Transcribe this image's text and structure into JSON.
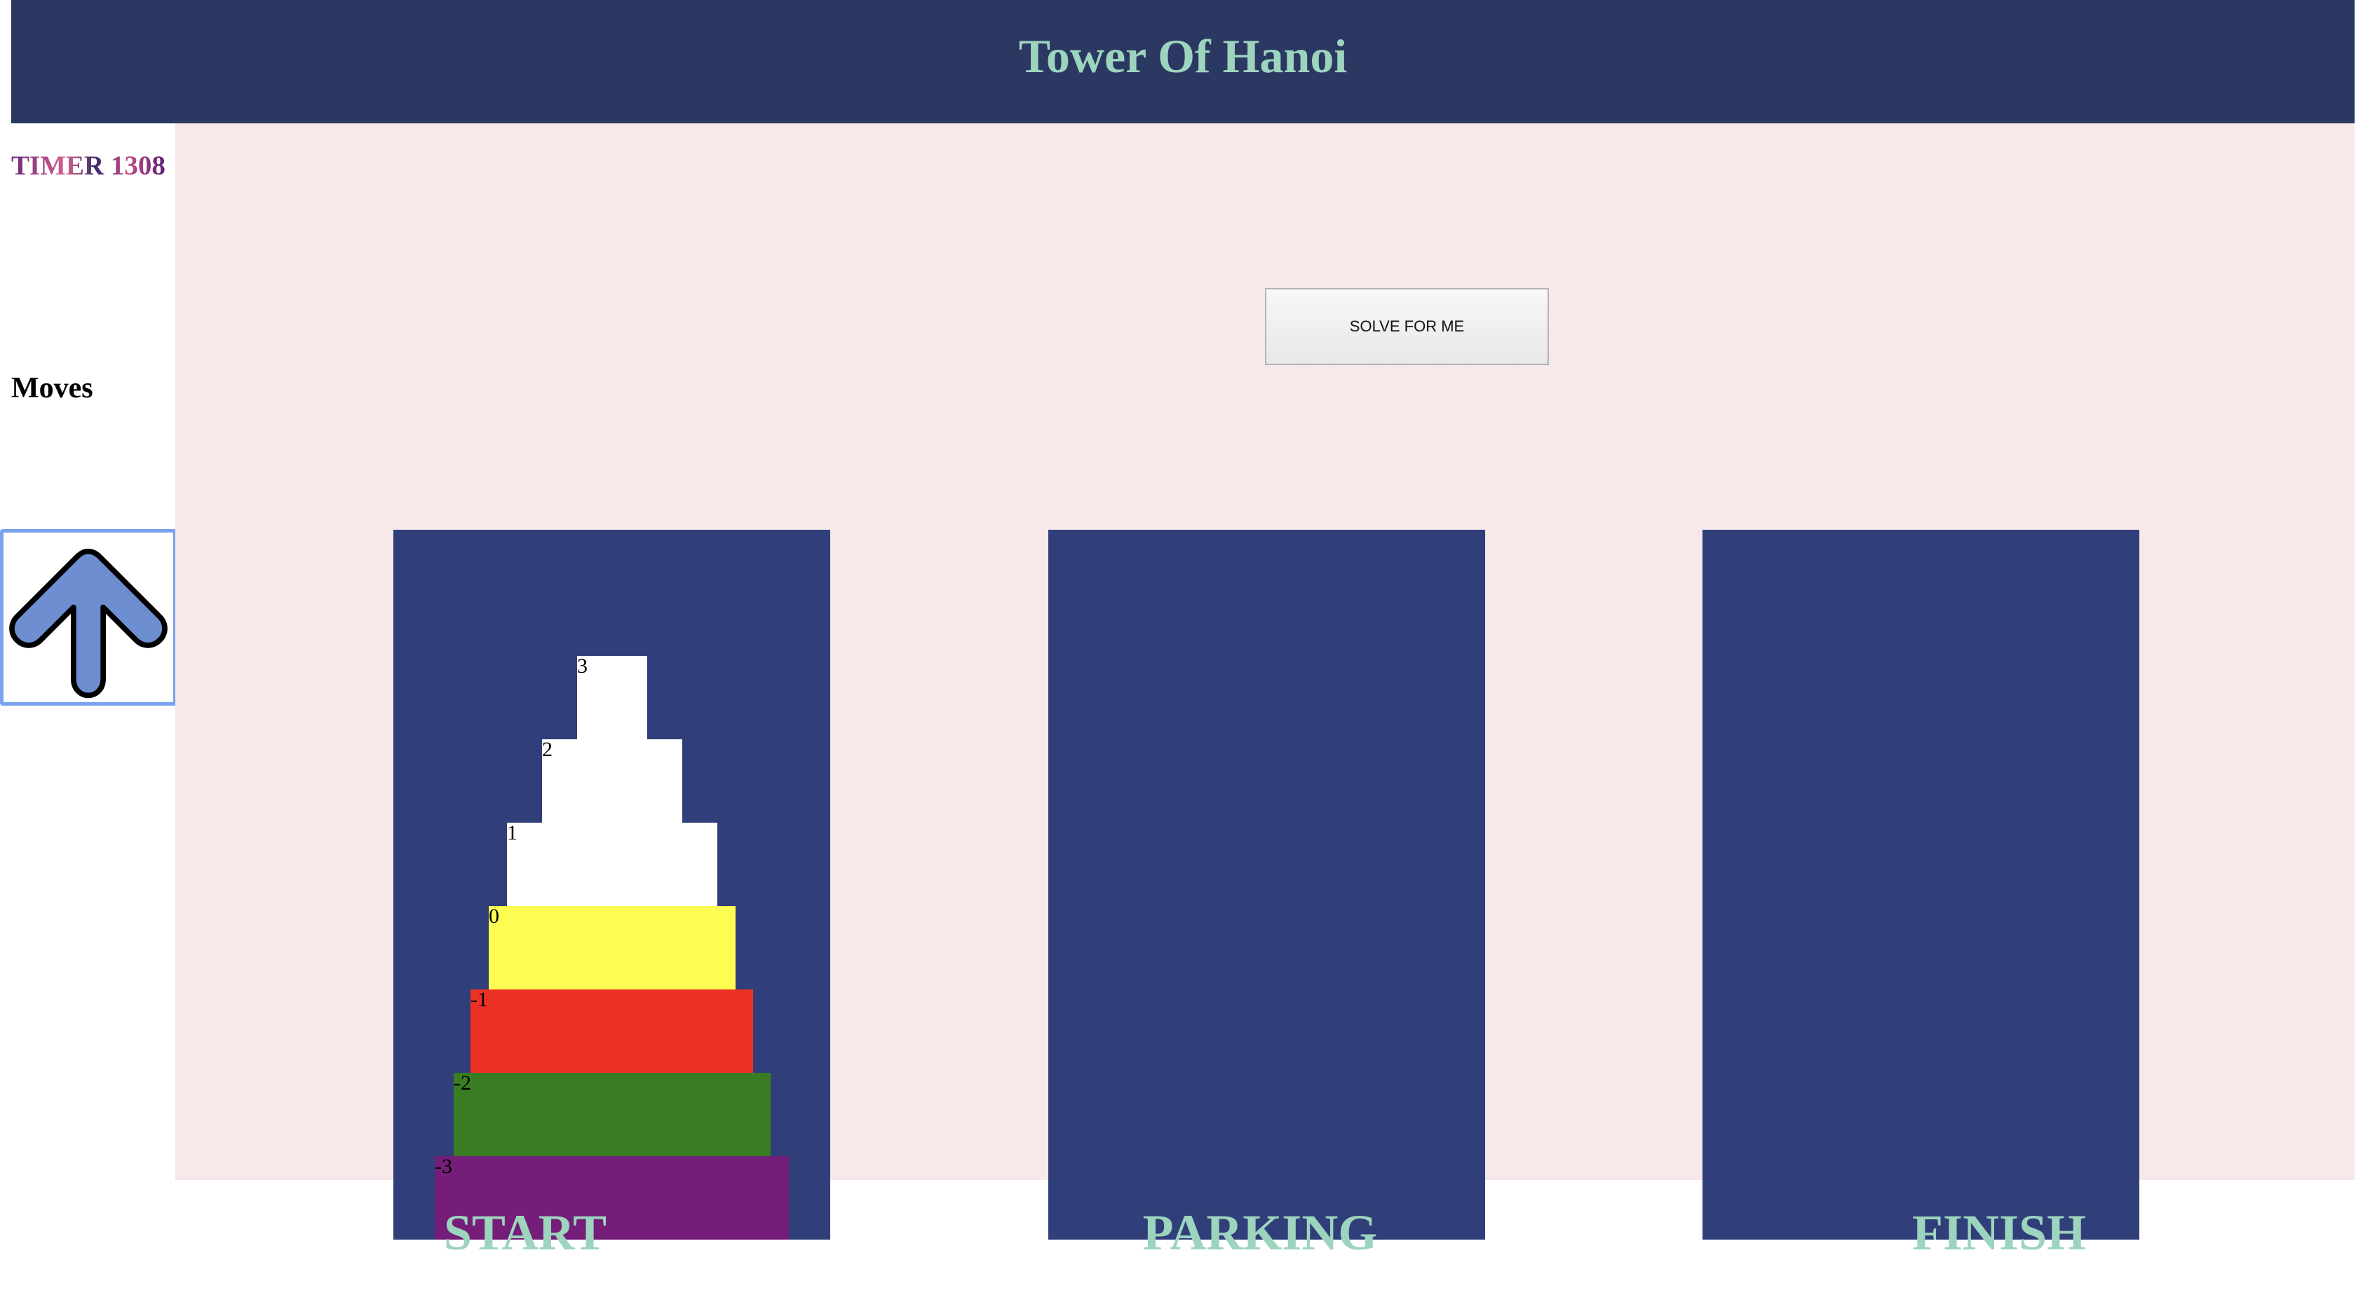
{
  "header": {
    "title": "Tower Of Hanoi"
  },
  "sidebar": {
    "timer_text": "TIMER 1308",
    "moves_label": "Moves",
    "arrow_icon": "up-arrow-icon"
  },
  "controls": {
    "solve_label": "SOLVE FOR ME"
  },
  "pegs": [
    {
      "label": "START",
      "disks": [
        "3",
        "2",
        "1",
        "0",
        "-1",
        "-2",
        "-3"
      ]
    },
    {
      "label": "PARKING",
      "disks": []
    },
    {
      "label": "FINISH",
      "disks": []
    }
  ],
  "colors": {
    "header_bg": "#2a3862",
    "title": "#9dd4bd",
    "board_bg": "#f7e8ea",
    "peg": "#303f7a",
    "disk_3": "#ffffff",
    "disk_2": "#ffffff",
    "disk_1": "#ffffff",
    "disk_0": "#fdfc52",
    "disk_-1": "#ec3225",
    "disk_-2": "#387c24",
    "disk_-3": "#741d79",
    "arrow_fill": "#6e8ed2"
  }
}
